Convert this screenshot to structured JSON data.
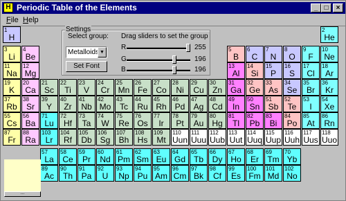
{
  "window": {
    "title": "Periodic Table of the Elements",
    "app_icon_letter": "H",
    "minimize_glyph": "_",
    "maximize_glyph": "□",
    "close_glyph": "×"
  },
  "menu": [
    {
      "label": "File",
      "accel": "F",
      "rest": "ile"
    },
    {
      "label": "Help",
      "accel": "H",
      "rest": "elp"
    }
  ],
  "settings": {
    "legend": "Settings",
    "select_group_label": "Select group:",
    "drag_label": "Drag sliders to set the group",
    "selected_group": "Metalloids",
    "set_font_label": "Set Font",
    "sliders": [
      {
        "channel": "R",
        "value": "255",
        "level": 1.0
      },
      {
        "channel": "G",
        "value": "196",
        "level": 0.77
      },
      {
        "channel": "B",
        "value": "196",
        "level": 0.77
      }
    ]
  },
  "sample_button_label": "...",
  "colors": {
    "alkali": "#ffffa8",
    "alkaline": "#ffc8ff",
    "transition": "#c8e0c8",
    "post_transition": "#ff80ff",
    "metalloid": "#ffc4c4",
    "nonmetal": "#c8c8ff",
    "halogen": "#80ffff",
    "noble": "#80ffff",
    "lanthanide": "#60ffff",
    "actinide": "#60ffff",
    "unknown": "#ffffff",
    "hydrogen": "#c8c8ff"
  },
  "elements": [
    {
      "n": "1",
      "s": "H",
      "c": "hydrogen",
      "r": 0,
      "col": 0
    },
    {
      "n": "2",
      "s": "He",
      "c": "noble",
      "r": 0,
      "col": 17
    },
    {
      "n": "3",
      "s": "Li",
      "c": "alkali",
      "r": 1,
      "col": 0
    },
    {
      "n": "4",
      "s": "Be",
      "c": "alkaline",
      "r": 1,
      "col": 1
    },
    {
      "n": "5",
      "s": "B",
      "c": "metalloid",
      "r": 1,
      "col": 12
    },
    {
      "n": "6",
      "s": "C",
      "c": "nonmetal",
      "r": 1,
      "col": 13
    },
    {
      "n": "7",
      "s": "N",
      "c": "nonmetal",
      "r": 1,
      "col": 14
    },
    {
      "n": "8",
      "s": "O",
      "c": "nonmetal",
      "r": 1,
      "col": 15
    },
    {
      "n": "9",
      "s": "F",
      "c": "halogen",
      "r": 1,
      "col": 16
    },
    {
      "n": "10",
      "s": "Ne",
      "c": "noble",
      "r": 1,
      "col": 17
    },
    {
      "n": "11",
      "s": "Na",
      "c": "alkali",
      "r": 2,
      "col": 0
    },
    {
      "n": "12",
      "s": "Mg",
      "c": "alkaline",
      "r": 2,
      "col": 1
    },
    {
      "n": "13",
      "s": "Al",
      "c": "post_transition",
      "r": 2,
      "col": 12
    },
    {
      "n": "14",
      "s": "Si",
      "c": "metalloid",
      "r": 2,
      "col": 13
    },
    {
      "n": "15",
      "s": "P",
      "c": "nonmetal",
      "r": 2,
      "col": 14
    },
    {
      "n": "16",
      "s": "S",
      "c": "nonmetal",
      "r": 2,
      "col": 15
    },
    {
      "n": "17",
      "s": "Cl",
      "c": "halogen",
      "r": 2,
      "col": 16
    },
    {
      "n": "18",
      "s": "Ar",
      "c": "noble",
      "r": 2,
      "col": 17
    },
    {
      "n": "19",
      "s": "K",
      "c": "alkali",
      "r": 3,
      "col": 0
    },
    {
      "n": "20",
      "s": "Ca",
      "c": "alkaline",
      "r": 3,
      "col": 1
    },
    {
      "n": "21",
      "s": "Sc",
      "c": "transition",
      "r": 3,
      "col": 2
    },
    {
      "n": "22",
      "s": "Ti",
      "c": "transition",
      "r": 3,
      "col": 3
    },
    {
      "n": "23",
      "s": "V",
      "c": "transition",
      "r": 3,
      "col": 4
    },
    {
      "n": "24",
      "s": "Cr",
      "c": "transition",
      "r": 3,
      "col": 5
    },
    {
      "n": "25",
      "s": "Mn",
      "c": "transition",
      "r": 3,
      "col": 6
    },
    {
      "n": "26",
      "s": "Fe",
      "c": "transition",
      "r": 3,
      "col": 7
    },
    {
      "n": "27",
      "s": "Co",
      "c": "transition",
      "r": 3,
      "col": 8
    },
    {
      "n": "28",
      "s": "Ni",
      "c": "transition",
      "r": 3,
      "col": 9
    },
    {
      "n": "29",
      "s": "Cu",
      "c": "transition",
      "r": 3,
      "col": 10
    },
    {
      "n": "30",
      "s": "Zn",
      "c": "transition",
      "r": 3,
      "col": 11
    },
    {
      "n": "31",
      "s": "Ga",
      "c": "post_transition",
      "r": 3,
      "col": 12
    },
    {
      "n": "32",
      "s": "Ge",
      "c": "metalloid",
      "r": 3,
      "col": 13
    },
    {
      "n": "33",
      "s": "As",
      "c": "metalloid",
      "r": 3,
      "col": 14
    },
    {
      "n": "34",
      "s": "Se",
      "c": "nonmetal",
      "r": 3,
      "col": 15
    },
    {
      "n": "35",
      "s": "Br",
      "c": "halogen",
      "r": 3,
      "col": 16
    },
    {
      "n": "36",
      "s": "Kr",
      "c": "noble",
      "r": 3,
      "col": 17
    },
    {
      "n": "37",
      "s": "Rb",
      "c": "alkali",
      "r": 4,
      "col": 0
    },
    {
      "n": "38",
      "s": "Sr",
      "c": "alkaline",
      "r": 4,
      "col": 1
    },
    {
      "n": "39",
      "s": "Y",
      "c": "transition",
      "r": 4,
      "col": 2
    },
    {
      "n": "40",
      "s": "Zr",
      "c": "transition",
      "r": 4,
      "col": 3
    },
    {
      "n": "41",
      "s": "Nb",
      "c": "transition",
      "r": 4,
      "col": 4
    },
    {
      "n": "42",
      "s": "Mo",
      "c": "transition",
      "r": 4,
      "col": 5
    },
    {
      "n": "43",
      "s": "Tc",
      "c": "transition",
      "r": 4,
      "col": 6
    },
    {
      "n": "44",
      "s": "Ru",
      "c": "transition",
      "r": 4,
      "col": 7
    },
    {
      "n": "45",
      "s": "Rh",
      "c": "transition",
      "r": 4,
      "col": 8
    },
    {
      "n": "46",
      "s": "Pd",
      "c": "transition",
      "r": 4,
      "col": 9
    },
    {
      "n": "47",
      "s": "Ag",
      "c": "transition",
      "r": 4,
      "col": 10
    },
    {
      "n": "48",
      "s": "Cd",
      "c": "transition",
      "r": 4,
      "col": 11
    },
    {
      "n": "49",
      "s": "In",
      "c": "post_transition",
      "r": 4,
      "col": 12
    },
    {
      "n": "50",
      "s": "Sn",
      "c": "post_transition",
      "r": 4,
      "col": 13
    },
    {
      "n": "51",
      "s": "Sb",
      "c": "metalloid",
      "r": 4,
      "col": 14
    },
    {
      "n": "52",
      "s": "Te",
      "c": "metalloid",
      "r": 4,
      "col": 15
    },
    {
      "n": "53",
      "s": "I",
      "c": "halogen",
      "r": 4,
      "col": 16
    },
    {
      "n": "54",
      "s": "Xe",
      "c": "noble",
      "r": 4,
      "col": 17
    },
    {
      "n": "55",
      "s": "Cs",
      "c": "alkali",
      "r": 5,
      "col": 0
    },
    {
      "n": "56",
      "s": "Ba",
      "c": "alkaline",
      "r": 5,
      "col": 1
    },
    {
      "n": "71",
      "s": "Lu",
      "c": "lanthanide",
      "r": 5,
      "col": 2
    },
    {
      "n": "72",
      "s": "Hf",
      "c": "transition",
      "r": 5,
      "col": 3
    },
    {
      "n": "73",
      "s": "Ta",
      "c": "transition",
      "r": 5,
      "col": 4
    },
    {
      "n": "74",
      "s": "W",
      "c": "transition",
      "r": 5,
      "col": 5
    },
    {
      "n": "75",
      "s": "Re",
      "c": "transition",
      "r": 5,
      "col": 6
    },
    {
      "n": "76",
      "s": "Os",
      "c": "transition",
      "r": 5,
      "col": 7
    },
    {
      "n": "77",
      "s": "Ir",
      "c": "transition",
      "r": 5,
      "col": 8
    },
    {
      "n": "78",
      "s": "Pt",
      "c": "transition",
      "r": 5,
      "col": 9
    },
    {
      "n": "79",
      "s": "Au",
      "c": "transition",
      "r": 5,
      "col": 10
    },
    {
      "n": "80",
      "s": "Hg",
      "c": "transition",
      "r": 5,
      "col": 11
    },
    {
      "n": "81",
      "s": "Tl",
      "c": "post_transition",
      "r": 5,
      "col": 12
    },
    {
      "n": "82",
      "s": "Pb",
      "c": "post_transition",
      "r": 5,
      "col": 13
    },
    {
      "n": "83",
      "s": "Bi",
      "c": "post_transition",
      "r": 5,
      "col": 14
    },
    {
      "n": "84",
      "s": "Po",
      "c": "metalloid",
      "r": 5,
      "col": 15
    },
    {
      "n": "85",
      "s": "At",
      "c": "halogen",
      "r": 5,
      "col": 16
    },
    {
      "n": "86",
      "s": "Rn",
      "c": "noble",
      "r": 5,
      "col": 17
    },
    {
      "n": "87",
      "s": "Fr",
      "c": "alkali",
      "r": 6,
      "col": 0
    },
    {
      "n": "88",
      "s": "Ra",
      "c": "alkaline",
      "r": 6,
      "col": 1
    },
    {
      "n": "103",
      "s": "Lr",
      "c": "actinide",
      "r": 6,
      "col": 2
    },
    {
      "n": "104",
      "s": "Rf",
      "c": "transition",
      "r": 6,
      "col": 3
    },
    {
      "n": "105",
      "s": "Db",
      "c": "transition",
      "r": 6,
      "col": 4
    },
    {
      "n": "106",
      "s": "Sg",
      "c": "transition",
      "r": 6,
      "col": 5
    },
    {
      "n": "107",
      "s": "Bh",
      "c": "transition",
      "r": 6,
      "col": 6
    },
    {
      "n": "108",
      "s": "Hs",
      "c": "transition",
      "r": 6,
      "col": 7
    },
    {
      "n": "109",
      "s": "Mt",
      "c": "transition",
      "r": 6,
      "col": 8
    },
    {
      "n": "110",
      "s": "Uun",
      "c": "unknown",
      "r": 6,
      "col": 9
    },
    {
      "n": "111",
      "s": "Uuu",
      "c": "unknown",
      "r": 6,
      "col": 10
    },
    {
      "n": "112",
      "s": "Uub",
      "c": "unknown",
      "r": 6,
      "col": 11
    },
    {
      "n": "113",
      "s": "Uut",
      "c": "unknown",
      "r": 6,
      "col": 12
    },
    {
      "n": "114",
      "s": "Uuq",
      "c": "unknown",
      "r": 6,
      "col": 13
    },
    {
      "n": "115",
      "s": "Uup",
      "c": "unknown",
      "r": 6,
      "col": 14
    },
    {
      "n": "116",
      "s": "Uuh",
      "c": "unknown",
      "r": 6,
      "col": 15
    },
    {
      "n": "117",
      "s": "Uus",
      "c": "unknown",
      "r": 6,
      "col": 16
    },
    {
      "n": "118",
      "s": "Uuo",
      "c": "unknown",
      "r": 6,
      "col": 17
    },
    {
      "n": "57",
      "s": "La",
      "c": "lanthanide",
      "r": 7,
      "col": 2
    },
    {
      "n": "58",
      "s": "Ce",
      "c": "lanthanide",
      "r": 7,
      "col": 3
    },
    {
      "n": "59",
      "s": "Pr",
      "c": "lanthanide",
      "r": 7,
      "col": 4
    },
    {
      "n": "60",
      "s": "Nd",
      "c": "lanthanide",
      "r": 7,
      "col": 5
    },
    {
      "n": "61",
      "s": "Pm",
      "c": "lanthanide",
      "r": 7,
      "col": 6
    },
    {
      "n": "62",
      "s": "Sm",
      "c": "lanthanide",
      "r": 7,
      "col": 7
    },
    {
      "n": "63",
      "s": "Eu",
      "c": "lanthanide",
      "r": 7,
      "col": 8
    },
    {
      "n": "64",
      "s": "Gd",
      "c": "lanthanide",
      "r": 7,
      "col": 9
    },
    {
      "n": "65",
      "s": "Tb",
      "c": "lanthanide",
      "r": 7,
      "col": 10
    },
    {
      "n": "66",
      "s": "Dy",
      "c": "lanthanide",
      "r": 7,
      "col": 11
    },
    {
      "n": "67",
      "s": "Ho",
      "c": "lanthanide",
      "r": 7,
      "col": 12
    },
    {
      "n": "68",
      "s": "Er",
      "c": "lanthanide",
      "r": 7,
      "col": 13
    },
    {
      "n": "69",
      "s": "Tm",
      "c": "lanthanide",
      "r": 7,
      "col": 14
    },
    {
      "n": "70",
      "s": "Yb",
      "c": "lanthanide",
      "r": 7,
      "col": 15
    },
    {
      "n": "89",
      "s": "Ac",
      "c": "actinide",
      "r": 8,
      "col": 2
    },
    {
      "n": "90",
      "s": "Th",
      "c": "actinide",
      "r": 8,
      "col": 3
    },
    {
      "n": "91",
      "s": "Pa",
      "c": "actinide",
      "r": 8,
      "col": 4
    },
    {
      "n": "92",
      "s": "U",
      "c": "actinide",
      "r": 8,
      "col": 5
    },
    {
      "n": "93",
      "s": "Np",
      "c": "actinide",
      "r": 8,
      "col": 6
    },
    {
      "n": "94",
      "s": "Pu",
      "c": "actinide",
      "r": 8,
      "col": 7
    },
    {
      "n": "95",
      "s": "Am",
      "c": "actinide",
      "r": 8,
      "col": 8
    },
    {
      "n": "96",
      "s": "Cm",
      "c": "actinide",
      "r": 8,
      "col": 9
    },
    {
      "n": "97",
      "s": "Bk",
      "c": "actinide",
      "r": 8,
      "col": 10
    },
    {
      "n": "98",
      "s": "Cf",
      "c": "actinide",
      "r": 8,
      "col": 11
    },
    {
      "n": "99",
      "s": "Es",
      "c": "actinide",
      "r": 8,
      "col": 12
    },
    {
      "n": "100",
      "s": "Fm",
      "c": "actinide",
      "r": 8,
      "col": 13
    },
    {
      "n": "101",
      "s": "Md",
      "c": "actinide",
      "r": 8,
      "col": 14
    },
    {
      "n": "102",
      "s": "No",
      "c": "actinide",
      "r": 8,
      "col": 15
    }
  ]
}
